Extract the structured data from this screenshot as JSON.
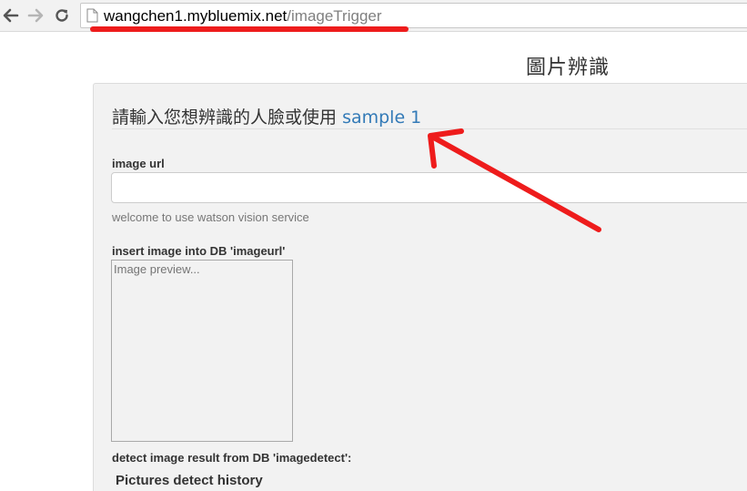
{
  "browser": {
    "url_host": "wangchen1.mybluemix.net",
    "url_path": "/imageTrigger",
    "icons": {
      "back": "arrow-left-icon",
      "forward": "arrow-right-icon",
      "reload": "reload-icon",
      "page": "page-icon"
    }
  },
  "page": {
    "header": "圖片辨識",
    "panel": {
      "title_text": "請輸入您想辨識的人臉或使用",
      "sample_link": "sample 1"
    },
    "image_url": {
      "label": "image url",
      "value": "",
      "help": "welcome to use watson vision service"
    },
    "insert": {
      "label": "insert image into DB 'imageurl'",
      "preview_placeholder": "Image preview..."
    },
    "detect": {
      "label": "detect image result from DB 'imagedetect':",
      "history_title": "Pictures detect history"
    }
  },
  "annotations": {
    "color": "#ee1c1c"
  }
}
